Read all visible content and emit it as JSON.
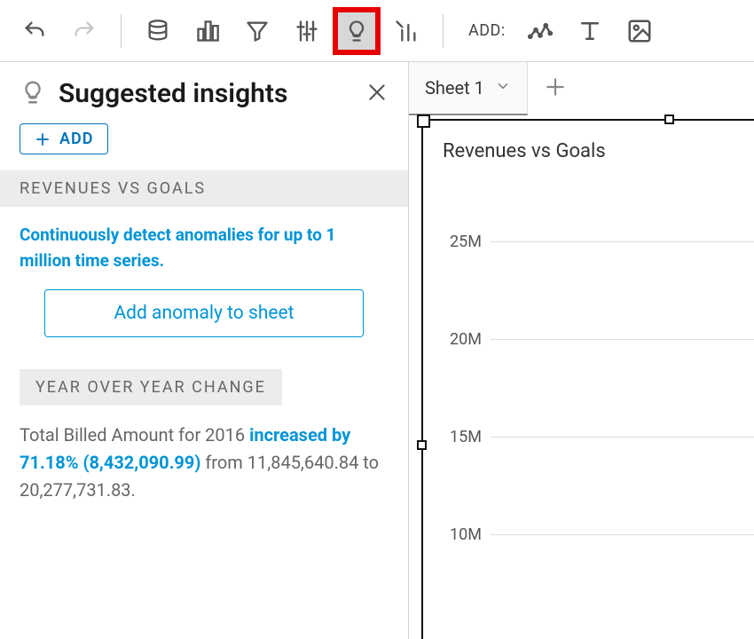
{
  "toolbar": {
    "add_label": "ADD:"
  },
  "panel": {
    "title": "Suggested insights",
    "add_button": "ADD",
    "sections": {
      "revenues_vs_goals": "REVENUES VS GOALS",
      "yoy_change": "YEAR OVER YEAR CHANGE"
    },
    "promo_text": "Continuously detect anomalies for up to 1 million time series.",
    "anomaly_button": "Add anomaly to sheet",
    "yoy": {
      "prefix": "Total Billed Amount for 2016 ",
      "highlight": "increased by 71.18% (8,432,090.99)",
      "from_label": " from ",
      "from_value": "11,845,640.84",
      "to_label": " to ",
      "to_value": "20,277,731.83",
      "suffix": "."
    }
  },
  "sheet": {
    "tab_label": "Sheet 1",
    "chart_title": "Revenues vs Goals"
  },
  "chart_data": {
    "type": "bar",
    "title": "Revenues vs Goals",
    "ylabel": "",
    "ylim": [
      0,
      25000000
    ],
    "y_ticks": [
      "25M",
      "20M",
      "15M",
      "10M"
    ],
    "categories": [],
    "series": []
  }
}
